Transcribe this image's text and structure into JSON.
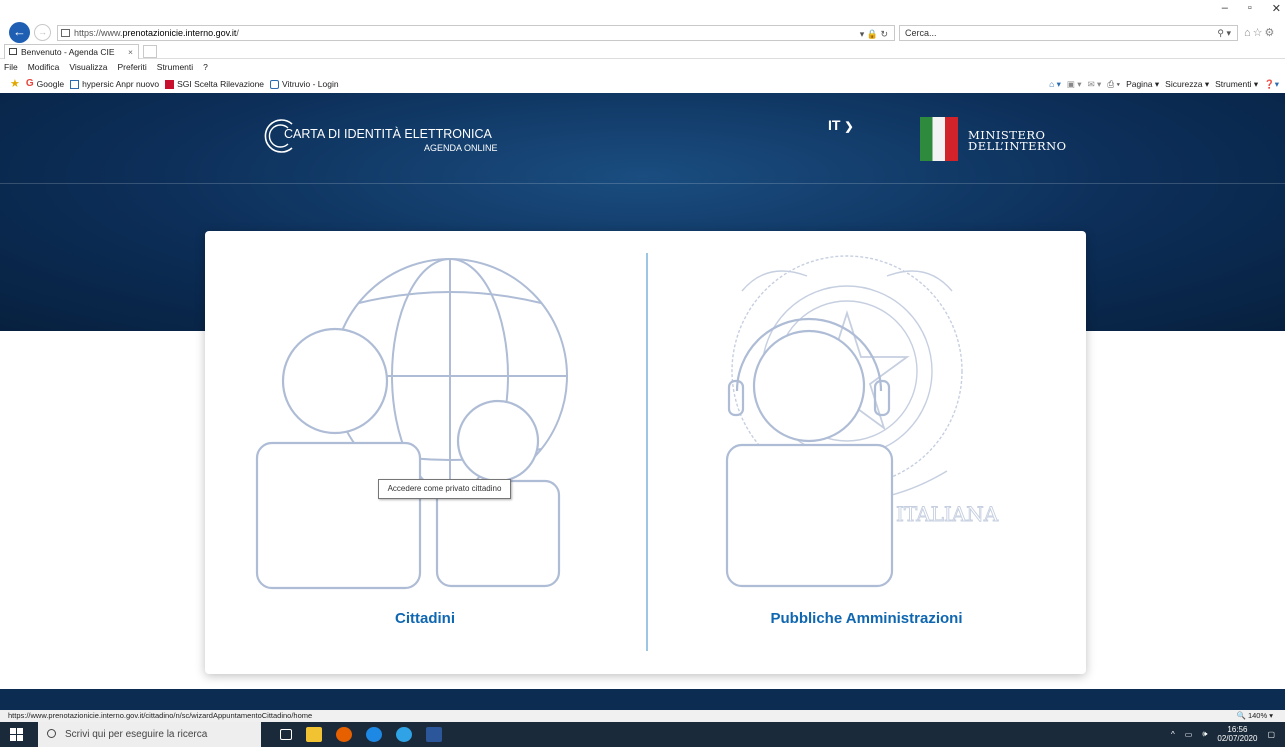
{
  "browser": {
    "url_prefix": "https://www.",
    "url_domain": "prenotazionicie.interno.gov.it",
    "url_suffix": "/",
    "address_tools": "▾ 🔒 ↻",
    "search_placeholder": "Cerca...",
    "tab_title": "Benvenuto - Agenda CIE",
    "menu": [
      "File",
      "Modifica",
      "Visualizza",
      "Preferiti",
      "Strumenti",
      "?"
    ],
    "favorites": [
      {
        "label": "Google",
        "icon": "google-icon",
        "color": "#e8453c"
      },
      {
        "label": "hypersic Anpr nuovo",
        "icon": "bookmark-icon",
        "color": "#2b6cb0"
      },
      {
        "label": "SGI Scelta Rilevazione",
        "icon": "bookmark-icon",
        "color": "#c8102e"
      },
      {
        "label": "Vitruvio - Login",
        "icon": "ie-page-icon",
        "color": "#2b6cb0"
      }
    ],
    "toolbar_right": [
      "Pagina ▾",
      "Sicurezza ▾",
      "Strumenti ▾"
    ],
    "status_url": "https://www.prenotazionicie.interno.gov.it/cittadino/n/sc/wizardAppuntamentoCittadino/home",
    "zoom": "140%"
  },
  "header": {
    "logo_title": "CARTA DI IDENTITÀ ELETTRONICA",
    "logo_subtitle": "AGENDA ONLINE",
    "language": "IT",
    "ministry_line1": "MINISTERO",
    "ministry_line2": "DELL’INTERNO"
  },
  "options": {
    "citizens_label": "Cittadini",
    "pa_label": "Pubbliche Amministrazioni",
    "tooltip": "Accedere come privato cittadino",
    "emblem_text": "ICA ITALIANA"
  },
  "taskbar": {
    "search_placeholder": "Scrivi qui per eseguire la ricerca",
    "time": "16:56",
    "date": "02/07/2020"
  },
  "colors": {
    "hero": "#0c2e58",
    "accent": "#0f67b1",
    "icon_stroke": "#aebcd6",
    "divider": "#9dc6e3"
  }
}
